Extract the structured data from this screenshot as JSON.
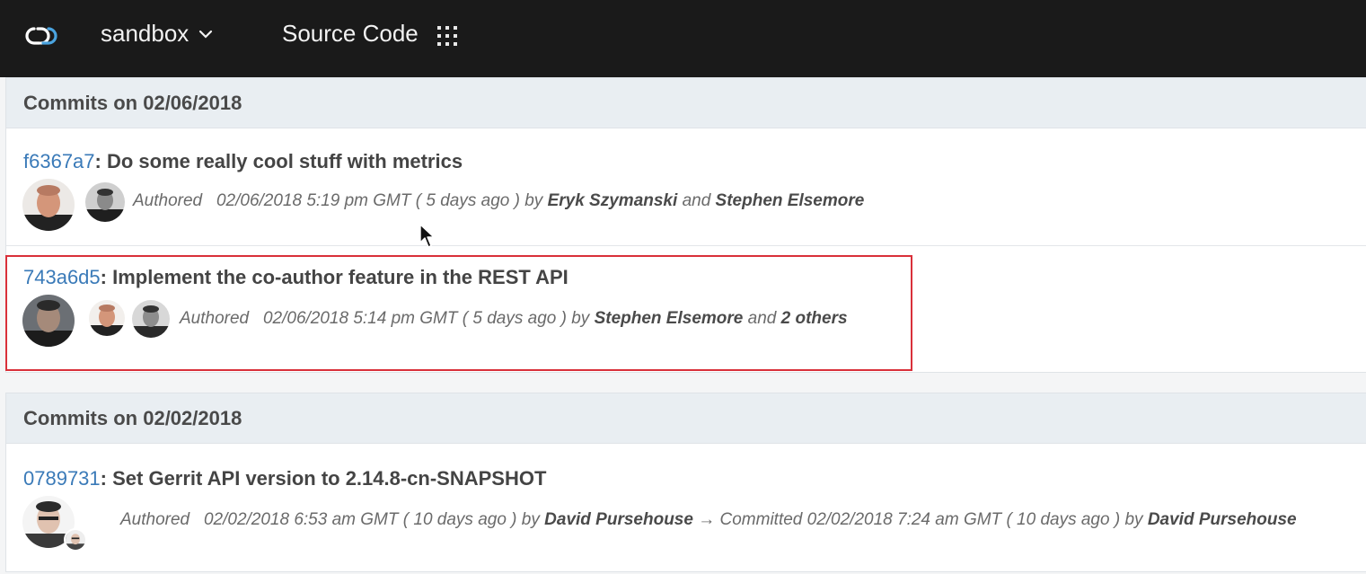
{
  "header": {
    "project_name": "sandbox",
    "section_title": "Source Code",
    "logo_icon": "cloud-logo-icon",
    "menu_icon": "grid-icon",
    "bg_color": "#1a1a1a"
  },
  "groups": [
    {
      "heading": "Commits on 02/06/2018",
      "commits": [
        {
          "sha": "f6367a7",
          "sep": ":",
          "message": "Do some really cool stuff with metrics",
          "authored_label": "Authored",
          "date": "02/06/2018 5:19 pm GMT",
          "relative": "( 5 days ago )",
          "by": "by",
          "author1": "Eryk Szymanski",
          "and": "and",
          "author2": "Stephen Elsemore"
        },
        {
          "sha": "743a6d5",
          "sep": ":",
          "message": "Implement the co-author feature in the REST API",
          "authored_label": "Authored",
          "date": "02/06/2018 5:14 pm GMT",
          "relative": "( 5 days ago )",
          "by": "by",
          "author1": "Stephen Elsemore",
          "and": "and",
          "author2": "2 others"
        }
      ]
    },
    {
      "heading": "Commits on 02/02/2018",
      "commits": [
        {
          "sha": "0789731",
          "sep": ":",
          "message": "Set Gerrit API version to 2.14.8-cn-SNAPSHOT",
          "authored_label": "Authored",
          "date": "02/02/2018 6:53 am GMT",
          "relative": "( 10 days ago )",
          "by": "by",
          "author1": "David Pursehouse",
          "arrow": "→",
          "committed_label": "Committed",
          "committed_date": "02/02/2018 7:24 am GMT",
          "committed_relative": "( 10 days ago )",
          "committed_by": "by",
          "committer": "David Pursehouse"
        }
      ]
    }
  ],
  "highlight_color": "#d9303a",
  "link_color": "#3a7ab8"
}
